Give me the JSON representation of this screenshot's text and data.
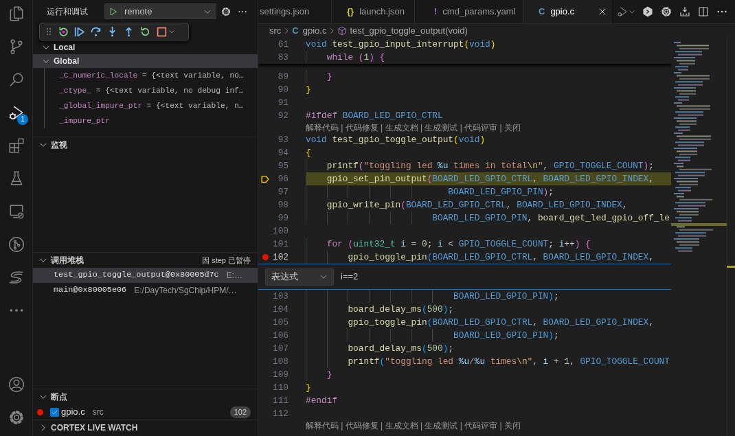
{
  "activity_bar": {
    "items": [
      {
        "kind": "files",
        "selected": false
      },
      {
        "kind": "source-control",
        "selected": false
      },
      {
        "kind": "search",
        "selected": false
      },
      {
        "kind": "run-debug",
        "selected": true,
        "badge": "1"
      },
      {
        "kind": "extensions",
        "selected": false
      },
      {
        "kind": "testing",
        "selected": false
      },
      {
        "kind": "remote",
        "selected": false
      },
      {
        "kind": "git-graph",
        "selected": false
      },
      {
        "kind": "s-logo",
        "selected": false
      },
      {
        "kind": "more",
        "selected": false
      }
    ],
    "bottom": [
      {
        "kind": "account"
      },
      {
        "kind": "settings"
      }
    ]
  },
  "sidebar": {
    "title": "运行和调试",
    "launch_config": "remote",
    "variables": {
      "scopes": [
        {
          "name": "Local",
          "expanded": true,
          "selected": false
        },
        {
          "name": "Global",
          "expanded": true,
          "selected": true,
          "children": [
            {
              "name": "_C_numeric_locale",
              "value": "= {<text variable, no…"
            },
            {
              "name": "_ctype_",
              "value": "= {<text variable, no debug inf…"
            },
            {
              "name": "_global_impure_ptr",
              "value": "= {<text variable, n…"
            },
            {
              "name": "_impure_ptr"
            }
          ]
        }
      ]
    },
    "watch": {
      "title": "监视",
      "expanded": true
    },
    "call_stack": {
      "title": "调用堆栈",
      "expanded": true,
      "status": "因 step 已暂停",
      "frames": [
        {
          "name": "test_gpio_toggle_output@0x80005d7c",
          "source": "E:…",
          "selected": true
        },
        {
          "name": "main@0x80005e06",
          "source": "E:/DayTech/SgChip/HPM/…",
          "selected": false
        }
      ]
    },
    "breakpoints": {
      "title": "断点",
      "expanded": true,
      "items": [
        {
          "file": "gpio.c",
          "folder": "src",
          "line": "102",
          "enabled": true
        }
      ]
    },
    "cortex_live_watch": {
      "title": "CORTEX LIVE WATCH",
      "expanded": false
    }
  },
  "editor": {
    "tabs": [
      {
        "label": "settings.json",
        "selected": false
      },
      {
        "label": "launch.json",
        "kind": "json",
        "icon": "{}",
        "selected": false
      },
      {
        "label": "cmd_params.yaml",
        "kind": "yaml",
        "icon": "!",
        "selected": false
      },
      {
        "label": "gpio.c",
        "kind": "c",
        "icon": "C",
        "selected": true
      }
    ],
    "breadcrumbs": [
      {
        "kind": "folder",
        "label": "src"
      },
      {
        "kind": "file",
        "icon": "C",
        "label": "gpio.c"
      },
      {
        "kind": "function",
        "label": "test_gpio_toggle_output(void)"
      }
    ],
    "sticky_lines": [
      {
        "number": "61",
        "tokens": [
          {
            "kind": "kw",
            "text": "void"
          },
          {
            "kind": "fn",
            "text": " test_gpio_input_interrupt"
          },
          {
            "kind": "b1",
            "text": "("
          },
          {
            "kind": "kw",
            "text": "void"
          },
          {
            "kind": "b1",
            "text": ")"
          }
        ]
      },
      {
        "number": "83",
        "tokens": [
          {
            "kind": "ctl",
            "text": "    while"
          },
          {
            "kind": "b2",
            "text": " ("
          },
          {
            "kind": "num",
            "text": "1"
          },
          {
            "kind": "b2",
            "text": ")"
          },
          {
            "kind": "b2",
            "text": " {"
          }
        ]
      }
    ],
    "lines": [
      {
        "kind": "code",
        "number": "89",
        "current": false,
        "breakpoint": false,
        "cursor": false,
        "tokens": [
          {
            "kind": "b2",
            "text": "    }"
          }
        ]
      },
      {
        "kind": "code",
        "number": "90",
        "current": false,
        "breakpoint": false,
        "cursor": false,
        "tokens": [
          {
            "kind": "b1",
            "text": "}"
          }
        ]
      },
      {
        "kind": "code",
        "number": "91",
        "current": false,
        "breakpoint": false,
        "cursor": false
      },
      {
        "kind": "code",
        "number": "92",
        "current": false,
        "breakpoint": false,
        "cursor": false,
        "tokens": [
          {
            "kind": "pp",
            "text": "#ifdef"
          },
          {
            "kind": "macro",
            "text": " BOARD_LED_GPIO_CTRL"
          }
        ]
      },
      {
        "kind": "lens",
        "text": "解释代码 | 代码修复 | 生成文档 | 生成测试 | 代码评审 | 关闭"
      },
      {
        "kind": "code",
        "number": "93",
        "current": false,
        "breakpoint": false,
        "cursor": false,
        "tokens": [
          {
            "kind": "kw",
            "text": "void"
          },
          {
            "kind": "fn",
            "text": " test_gpio_toggle_output"
          },
          {
            "kind": "b1",
            "text": "("
          },
          {
            "kind": "kw",
            "text": "void"
          },
          {
            "kind": "b1",
            "text": ")"
          }
        ]
      },
      {
        "kind": "code",
        "number": "94",
        "current": false,
        "breakpoint": false,
        "cursor": false,
        "tokens": [
          {
            "kind": "b1",
            "text": "{"
          }
        ]
      },
      {
        "kind": "code",
        "number": "95",
        "current": false,
        "breakpoint": false,
        "cursor": false,
        "tokens": [
          {
            "kind": "fn",
            "text": "    printf"
          },
          {
            "kind": "b2",
            "text": "("
          },
          {
            "kind": "str",
            "text": "\"toggling led "
          },
          {
            "kind": "var",
            "text": "%u"
          },
          {
            "kind": "str",
            "text": " times in total"
          },
          {
            "kind": "esc",
            "text": "\\n"
          },
          {
            "kind": "str",
            "text": "\""
          },
          {
            "kind": "p",
            "text": ","
          },
          {
            "kind": "macro",
            "text": " GPIO_TOGGLE_COUNT"
          },
          {
            "kind": "b2",
            "text": ")"
          },
          {
            "kind": "p",
            "text": ";"
          }
        ]
      },
      {
        "kind": "code",
        "number": "96",
        "current": true,
        "breakpoint": false,
        "cursor": false,
        "tokens": [
          {
            "kind": "fn",
            "text": "    gpio_set_pin_output"
          },
          {
            "kind": "b2",
            "text": "("
          },
          {
            "kind": "macro",
            "text": "BOARD_LED_GPIO_CTRL"
          },
          {
            "kind": "p",
            "text": ","
          },
          {
            "kind": "macro",
            "text": " BOARD_LED_GPIO_INDEX"
          },
          {
            "kind": "p",
            "text": ","
          }
        ]
      },
      {
        "kind": "code",
        "number": "97",
        "current": false,
        "breakpoint": false,
        "cursor": false,
        "tokens": [
          {
            "kind": "macro",
            "text": "                           BOARD_LED_GPIO_PIN"
          },
          {
            "kind": "b2",
            "text": ")"
          },
          {
            "kind": "p",
            "text": ";"
          }
        ]
      },
      {
        "kind": "code",
        "number": "98",
        "current": false,
        "breakpoint": false,
        "cursor": false,
        "tokens": [
          {
            "kind": "fn",
            "text": "    gpio_write_pin"
          },
          {
            "kind": "b2",
            "text": "("
          },
          {
            "kind": "macro",
            "text": "BOARD_LED_GPIO_CTRL"
          },
          {
            "kind": "p",
            "text": ","
          },
          {
            "kind": "macro",
            "text": " BOARD_LED_GPIO_INDEX"
          },
          {
            "kind": "p",
            "text": ","
          }
        ]
      },
      {
        "kind": "code",
        "number": "99",
        "current": false,
        "breakpoint": false,
        "cursor": false,
        "tokens": [
          {
            "kind": "macro",
            "text": "                        BOARD_LED_GPIO_PIN"
          },
          {
            "kind": "p",
            "text": ","
          },
          {
            "kind": "fn",
            "text": " board_get_led_gpio_off_le"
          }
        ]
      },
      {
        "kind": "code",
        "number": "100",
        "current": false,
        "breakpoint": false,
        "cursor": false
      },
      {
        "kind": "code",
        "number": "101",
        "current": false,
        "breakpoint": false,
        "cursor": false,
        "tokens": [
          {
            "kind": "ctl",
            "text": "    for"
          },
          {
            "kind": "b2",
            "text": " ("
          },
          {
            "kind": "type",
            "text": "uint32_t"
          },
          {
            "kind": "var",
            "text": " i"
          },
          {
            "kind": "p",
            "text": " ="
          },
          {
            "kind": "num",
            "text": " 0"
          },
          {
            "kind": "p",
            "text": ";"
          },
          {
            "kind": "var",
            "text": " i"
          },
          {
            "kind": "p",
            "text": " <"
          },
          {
            "kind": "macro",
            "text": " GPIO_TOGGLE_COUNT"
          },
          {
            "kind": "p",
            "text": ";"
          },
          {
            "kind": "var",
            "text": " i"
          },
          {
            "kind": "p",
            "text": "++"
          },
          {
            "kind": "b2",
            "text": ")"
          },
          {
            "kind": "b2",
            "text": " {"
          }
        ]
      },
      {
        "kind": "code",
        "number": "102",
        "current": false,
        "breakpoint": true,
        "cursor": true,
        "tokens": [
          {
            "kind": "fn",
            "text": "        gpio_toggle_pin"
          },
          {
            "kind": "b3",
            "text": "("
          },
          {
            "kind": "macro",
            "text": "BOARD_LED_GPIO_CTRL"
          },
          {
            "kind": "p",
            "text": ","
          },
          {
            "kind": "macro",
            "text": " BOARD_LED_GPIO_INDEX"
          },
          {
            "kind": "p",
            "text": ","
          }
        ]
      },
      {
        "kind": "condition",
        "type_label": "表达式",
        "value": "i==2"
      },
      {
        "kind": "code",
        "number": "103",
        "current": false,
        "breakpoint": false,
        "cursor": false,
        "tokens": [
          {
            "kind": "macro",
            "text": "                            BOARD_LED_GPIO_PIN"
          },
          {
            "kind": "b3",
            "text": ")"
          },
          {
            "kind": "p",
            "text": ";"
          }
        ]
      },
      {
        "kind": "code",
        "number": "104",
        "current": false,
        "breakpoint": false,
        "cursor": false,
        "tokens": [
          {
            "kind": "fn",
            "text": "        board_delay_ms"
          },
          {
            "kind": "b3",
            "text": "("
          },
          {
            "kind": "num",
            "text": "500"
          },
          {
            "kind": "b3",
            "text": ")"
          },
          {
            "kind": "p",
            "text": ";"
          }
        ]
      },
      {
        "kind": "code",
        "number": "105",
        "current": false,
        "breakpoint": false,
        "cursor": false,
        "tokens": [
          {
            "kind": "fn",
            "text": "        gpio_toggle_pin"
          },
          {
            "kind": "b3",
            "text": "("
          },
          {
            "kind": "macro",
            "text": "BOARD_LED_GPIO_CTRL"
          },
          {
            "kind": "p",
            "text": ","
          },
          {
            "kind": "macro",
            "text": " BOARD_LED_GPIO_INDEX"
          },
          {
            "kind": "p",
            "text": ","
          }
        ]
      },
      {
        "kind": "code",
        "number": "106",
        "current": false,
        "breakpoint": false,
        "cursor": false,
        "tokens": [
          {
            "kind": "macro",
            "text": "                            BOARD_LED_GPIO_PIN"
          },
          {
            "kind": "b3",
            "text": ")"
          },
          {
            "kind": "p",
            "text": ";"
          }
        ]
      },
      {
        "kind": "code",
        "number": "107",
        "current": false,
        "breakpoint": false,
        "cursor": false,
        "tokens": [
          {
            "kind": "fn",
            "text": "        board_delay_ms"
          },
          {
            "kind": "b3",
            "text": "("
          },
          {
            "kind": "num",
            "text": "500"
          },
          {
            "kind": "b3",
            "text": ")"
          },
          {
            "kind": "p",
            "text": ";"
          }
        ]
      },
      {
        "kind": "code",
        "number": "108",
        "current": false,
        "breakpoint": false,
        "cursor": false,
        "tokens": [
          {
            "kind": "fn",
            "text": "        printf"
          },
          {
            "kind": "b3",
            "text": "("
          },
          {
            "kind": "str",
            "text": "\"toggling led "
          },
          {
            "kind": "var",
            "text": "%u"
          },
          {
            "kind": "str",
            "text": "/"
          },
          {
            "kind": "var",
            "text": "%u"
          },
          {
            "kind": "str",
            "text": " times"
          },
          {
            "kind": "esc",
            "text": "\\n"
          },
          {
            "kind": "str",
            "text": "\""
          },
          {
            "kind": "p",
            "text": ","
          },
          {
            "kind": "var",
            "text": " i"
          },
          {
            "kind": "p",
            "text": " +"
          },
          {
            "kind": "num",
            "text": " 1"
          },
          {
            "kind": "p",
            "text": ","
          },
          {
            "kind": "macro",
            "text": " GPIO_TOGGLE_COUNT"
          }
        ]
      },
      {
        "kind": "code",
        "number": "109",
        "current": false,
        "breakpoint": false,
        "cursor": false,
        "tokens": [
          {
            "kind": "b2",
            "text": "    }"
          }
        ]
      },
      {
        "kind": "code",
        "number": "110",
        "current": false,
        "breakpoint": false,
        "cursor": false,
        "tokens": [
          {
            "kind": "b1",
            "text": "}"
          }
        ]
      },
      {
        "kind": "code",
        "number": "111",
        "current": false,
        "breakpoint": false,
        "cursor": false,
        "tokens": [
          {
            "kind": "pp",
            "text": "#endif"
          }
        ]
      },
      {
        "kind": "code",
        "number": "112",
        "current": false,
        "breakpoint": false,
        "cursor": false
      },
      {
        "kind": "lens",
        "text": "解释代码 | 代码修复 | 生成文档 | 生成测试 | 代码评审 | 关闭"
      }
    ]
  }
}
